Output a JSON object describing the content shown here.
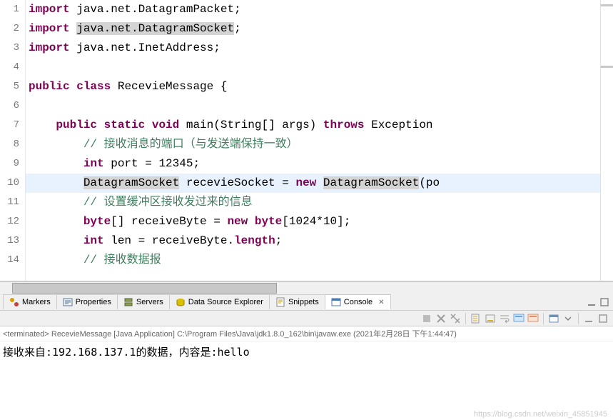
{
  "code": {
    "lines": [
      {
        "n": "1",
        "segs": [
          {
            "t": "import",
            "c": "kw"
          },
          {
            "t": " java.net.DatagramPacket;",
            "c": ""
          }
        ]
      },
      {
        "n": "2",
        "segs": [
          {
            "t": "import",
            "c": "kw"
          },
          {
            "t": " ",
            "c": ""
          },
          {
            "t": "java.net.DatagramSocket",
            "c": "type-hl"
          },
          {
            "t": ";",
            "c": ""
          }
        ]
      },
      {
        "n": "3",
        "segs": [
          {
            "t": "import",
            "c": "kw"
          },
          {
            "t": " java.net.InetAddress;",
            "c": ""
          }
        ]
      },
      {
        "n": "4",
        "segs": []
      },
      {
        "n": "5",
        "segs": [
          {
            "t": "public",
            "c": "kw"
          },
          {
            "t": " ",
            "c": ""
          },
          {
            "t": "class",
            "c": "kw"
          },
          {
            "t": " RecevieMessage {",
            "c": ""
          }
        ]
      },
      {
        "n": "6",
        "segs": []
      },
      {
        "n": "7",
        "segs": [
          {
            "t": "    ",
            "c": ""
          },
          {
            "t": "public",
            "c": "kw"
          },
          {
            "t": " ",
            "c": ""
          },
          {
            "t": "static",
            "c": "kw"
          },
          {
            "t": " ",
            "c": ""
          },
          {
            "t": "void",
            "c": "kw"
          },
          {
            "t": " main(String[] args) ",
            "c": ""
          },
          {
            "t": "throws",
            "c": "kw"
          },
          {
            "t": " Exception ",
            "c": ""
          }
        ]
      },
      {
        "n": "8",
        "segs": [
          {
            "t": "        ",
            "c": ""
          },
          {
            "t": "// 接收消息的端口（与发送端保持一致）",
            "c": "cm"
          }
        ]
      },
      {
        "n": "9",
        "segs": [
          {
            "t": "        ",
            "c": ""
          },
          {
            "t": "int",
            "c": "kw"
          },
          {
            "t": " port = 12345;",
            "c": ""
          }
        ]
      },
      {
        "n": "10",
        "hl": true,
        "segs": [
          {
            "t": "        ",
            "c": ""
          },
          {
            "t": "DatagramSocket",
            "c": "type-hl"
          },
          {
            "t": " recevieSocket = ",
            "c": ""
          },
          {
            "t": "new",
            "c": "kw"
          },
          {
            "t": " ",
            "c": ""
          },
          {
            "t": "DatagramSocket",
            "c": "type-hl"
          },
          {
            "t": "(po",
            "c": ""
          }
        ]
      },
      {
        "n": "11",
        "segs": [
          {
            "t": "        ",
            "c": ""
          },
          {
            "t": "// 设置缓冲区接收发过来的信息",
            "c": "cm"
          }
        ]
      },
      {
        "n": "12",
        "segs": [
          {
            "t": "        ",
            "c": ""
          },
          {
            "t": "byte",
            "c": "kw"
          },
          {
            "t": "[] receiveByte = ",
            "c": ""
          },
          {
            "t": "new",
            "c": "kw"
          },
          {
            "t": " ",
            "c": ""
          },
          {
            "t": "byte",
            "c": "kw"
          },
          {
            "t": "[1024*10];",
            "c": ""
          }
        ]
      },
      {
        "n": "13",
        "segs": [
          {
            "t": "        ",
            "c": ""
          },
          {
            "t": "int",
            "c": "kw"
          },
          {
            "t": " len = receiveByte.",
            "c": ""
          },
          {
            "t": "length",
            "c": "kw"
          },
          {
            "t": ";",
            "c": ""
          }
        ]
      },
      {
        "n": "14",
        "segs": [
          {
            "t": "        ",
            "c": ""
          },
          {
            "t": "// 接收数据报",
            "c": "cm"
          }
        ]
      }
    ]
  },
  "tabs": {
    "items": [
      {
        "label": "Markers",
        "icon": "markers"
      },
      {
        "label": "Properties",
        "icon": "properties"
      },
      {
        "label": "Servers",
        "icon": "servers"
      },
      {
        "label": "Data Source Explorer",
        "icon": "datasource"
      },
      {
        "label": "Snippets",
        "icon": "snippets"
      },
      {
        "label": "Console",
        "icon": "console",
        "active": true
      }
    ]
  },
  "console": {
    "header": "<terminated> RecevieMessage [Java Application] C:\\Program Files\\Java\\jdk1.8.0_162\\bin\\javaw.exe (2021年2月28日 下午1:44:47)",
    "output_prefix": "接收来自:",
    "output_ip": "192.168.137.1",
    "output_suffix": "的数据，内容是:hello"
  },
  "watermark": "https://blog.csdn.net/weixin_45851945"
}
